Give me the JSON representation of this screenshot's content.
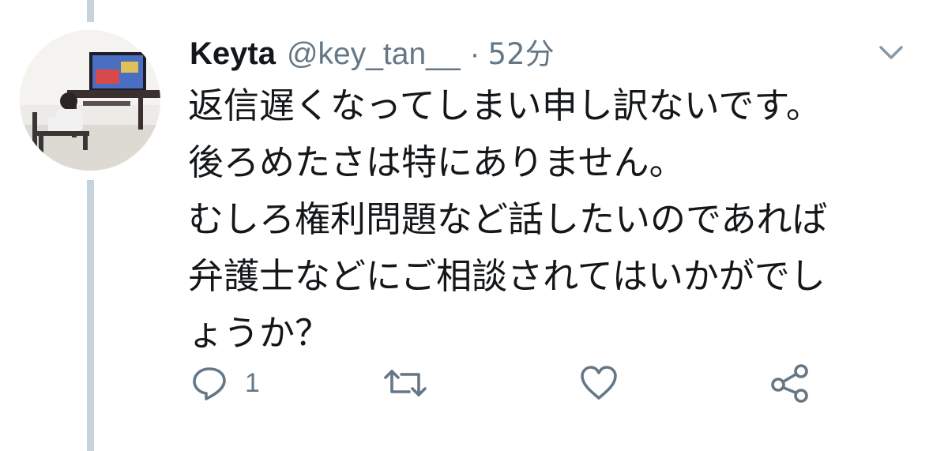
{
  "tweet": {
    "display_name": "Keyta",
    "handle": "@key_tan__",
    "separator": "·",
    "time": "52分",
    "lines": [
      "返信遅くなってしまい申し訳ないです。",
      "後ろめたさは特にありません。",
      "むしろ権利問題など話したいのであれば",
      "弁護士などにご相談されてはいかがでし",
      "ょうか？"
    ]
  },
  "actions": {
    "reply_count": "1"
  },
  "icons": {
    "reply": "reply-icon",
    "retweet": "retweet-icon",
    "like": "heart-icon",
    "share": "share-icon",
    "menu": "chevron-down-icon"
  },
  "colors": {
    "text": "#14171a",
    "secondary": "#657786",
    "thread_line": "#c7d3dc"
  }
}
